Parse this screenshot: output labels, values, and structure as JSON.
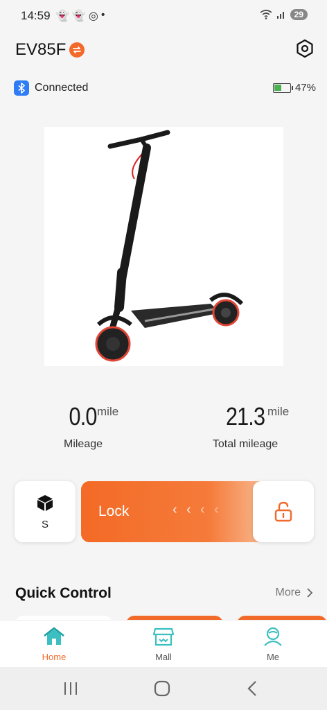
{
  "status_bar": {
    "time": "14:59",
    "battery": "29"
  },
  "header": {
    "device_name": "EV85F"
  },
  "connection": {
    "status": "Connected",
    "battery_percent": "47%",
    "battery_level": 0.47
  },
  "stats": {
    "mileage": {
      "value": "0.0",
      "unit": "mile",
      "label": "Mileage"
    },
    "total": {
      "value": "21.3",
      "unit": "mile",
      "label": "Total mileage"
    }
  },
  "mode": {
    "label": "S"
  },
  "lock": {
    "label": "Lock"
  },
  "quick_control": {
    "title": "Quick Control",
    "more": "More"
  },
  "tabs": [
    {
      "label": "Home",
      "active": true
    },
    {
      "label": "Mall",
      "active": false
    },
    {
      "label": "Me",
      "active": false
    }
  ],
  "colors": {
    "accent": "#f26a2a",
    "tab_icon": "#3bbfc0",
    "bluetooth": "#2e7cf6"
  }
}
